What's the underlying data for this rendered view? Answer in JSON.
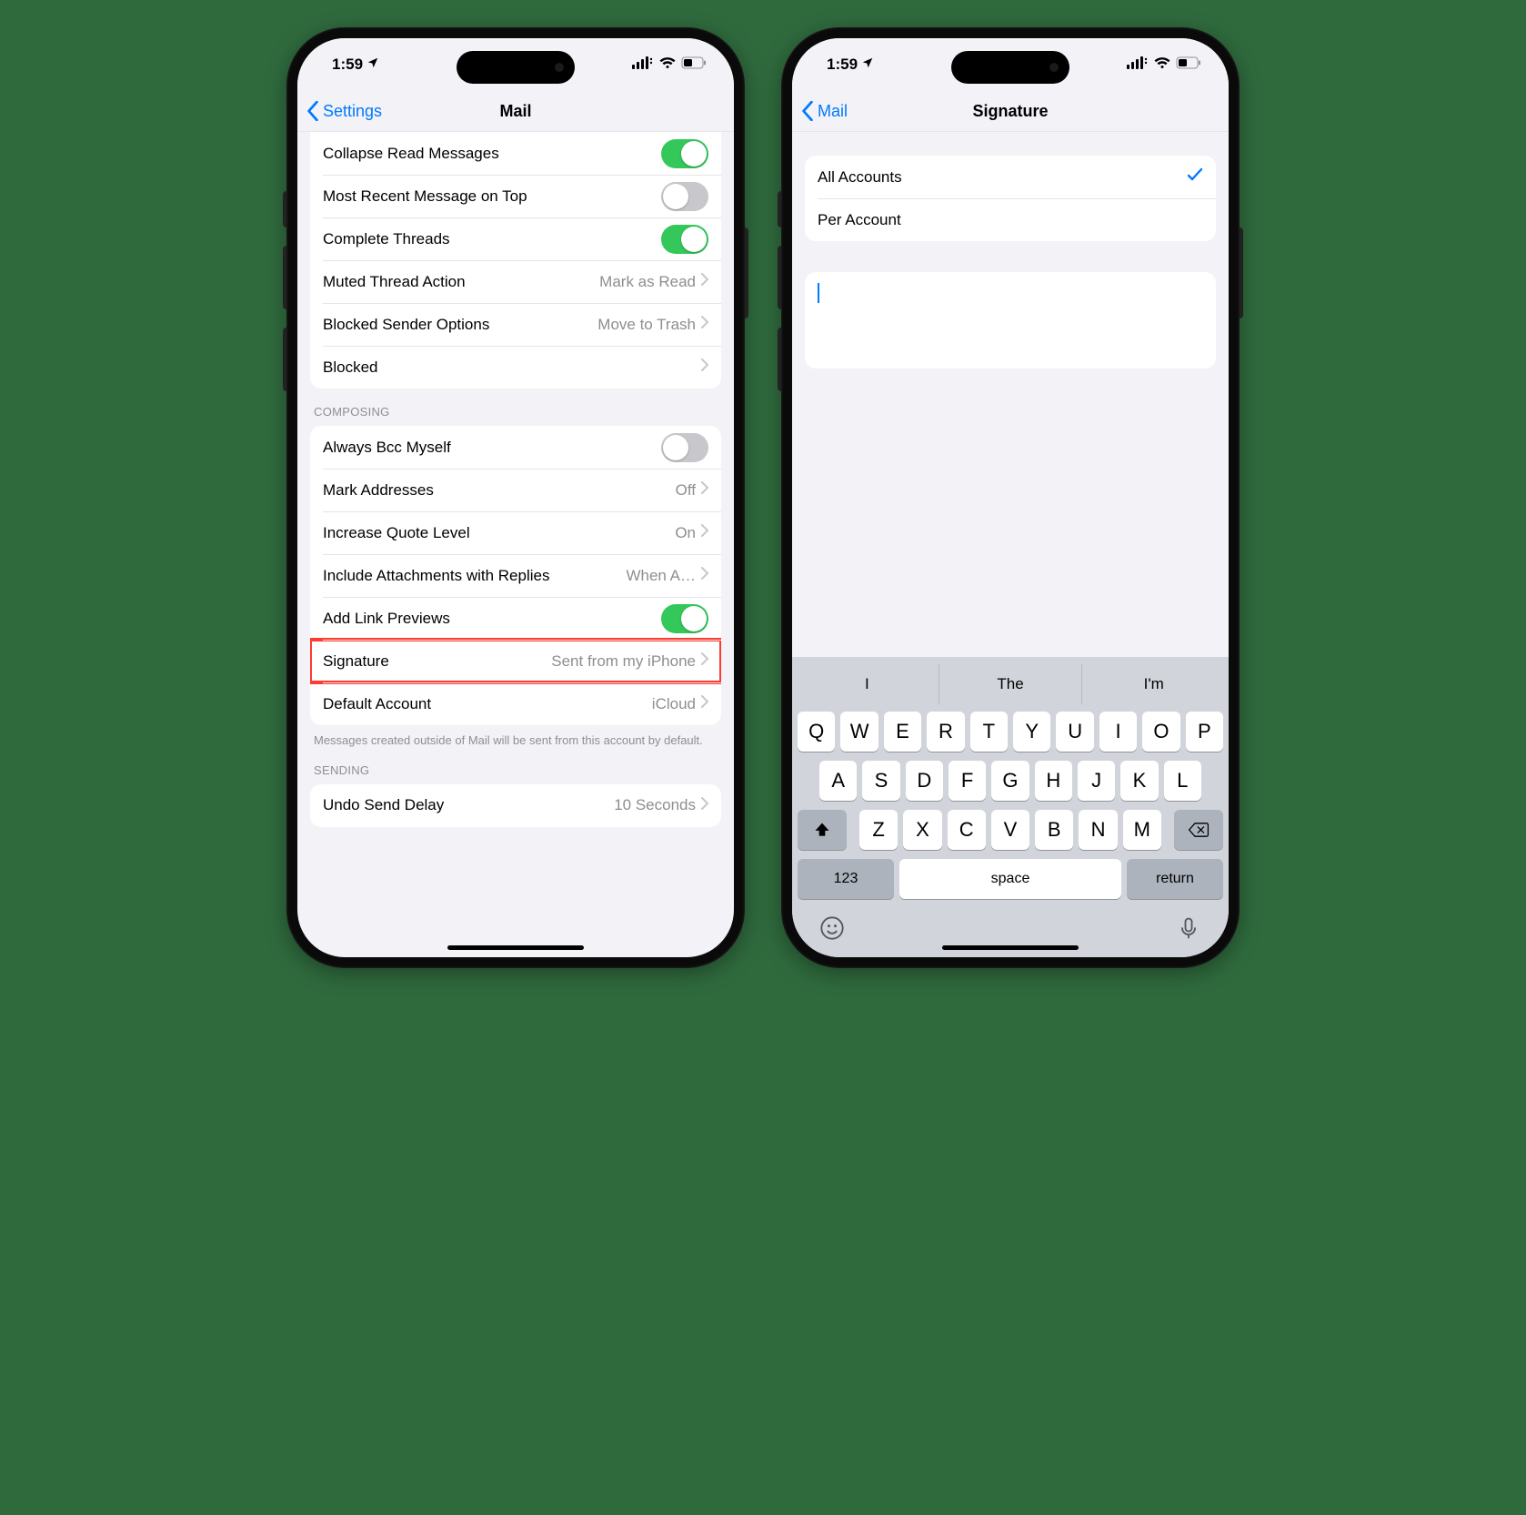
{
  "status": {
    "time": "1:59",
    "location_on": true
  },
  "left": {
    "nav_back": "Settings",
    "nav_title": "Mail",
    "threading": [
      {
        "label": "Collapse Read Messages",
        "type": "toggle",
        "on": true
      },
      {
        "label": "Most Recent Message on Top",
        "type": "toggle",
        "on": false
      },
      {
        "label": "Complete Threads",
        "type": "toggle",
        "on": true
      },
      {
        "label": "Muted Thread Action",
        "type": "link",
        "value": "Mark as Read"
      },
      {
        "label": "Blocked Sender Options",
        "type": "link",
        "value": "Move to Trash"
      },
      {
        "label": "Blocked",
        "type": "link",
        "value": ""
      }
    ],
    "composing_header": "COMPOSING",
    "composing": [
      {
        "label": "Always Bcc Myself",
        "type": "toggle",
        "on": false
      },
      {
        "label": "Mark Addresses",
        "type": "link",
        "value": "Off"
      },
      {
        "label": "Increase Quote Level",
        "type": "link",
        "value": "On"
      },
      {
        "label": "Include Attachments with Replies",
        "type": "link",
        "value": "When A…"
      },
      {
        "label": "Add Link Previews",
        "type": "toggle",
        "on": true
      },
      {
        "label": "Signature",
        "type": "link",
        "value": "Sent from my iPhone",
        "highlight": true
      },
      {
        "label": "Default Account",
        "type": "link",
        "value": "iCloud"
      }
    ],
    "composing_footer": "Messages created outside of Mail will be sent from this account by default.",
    "sending_header": "SENDING",
    "sending": [
      {
        "label": "Undo Send Delay",
        "type": "link",
        "value": "10 Seconds"
      }
    ]
  },
  "right": {
    "nav_back": "Mail",
    "nav_title": "Signature",
    "options": [
      {
        "label": "All Accounts",
        "checked": true
      },
      {
        "label": "Per Account",
        "checked": false
      }
    ],
    "signature_text": "",
    "keyboard": {
      "suggestions": [
        "I",
        "The",
        "I'm"
      ],
      "row1": [
        "Q",
        "W",
        "E",
        "R",
        "T",
        "Y",
        "U",
        "I",
        "O",
        "P"
      ],
      "row2": [
        "A",
        "S",
        "D",
        "F",
        "G",
        "H",
        "J",
        "K",
        "L"
      ],
      "row3": [
        "Z",
        "X",
        "C",
        "V",
        "B",
        "N",
        "M"
      ],
      "num_key": "123",
      "space_key": "space",
      "return_key": "return"
    }
  }
}
